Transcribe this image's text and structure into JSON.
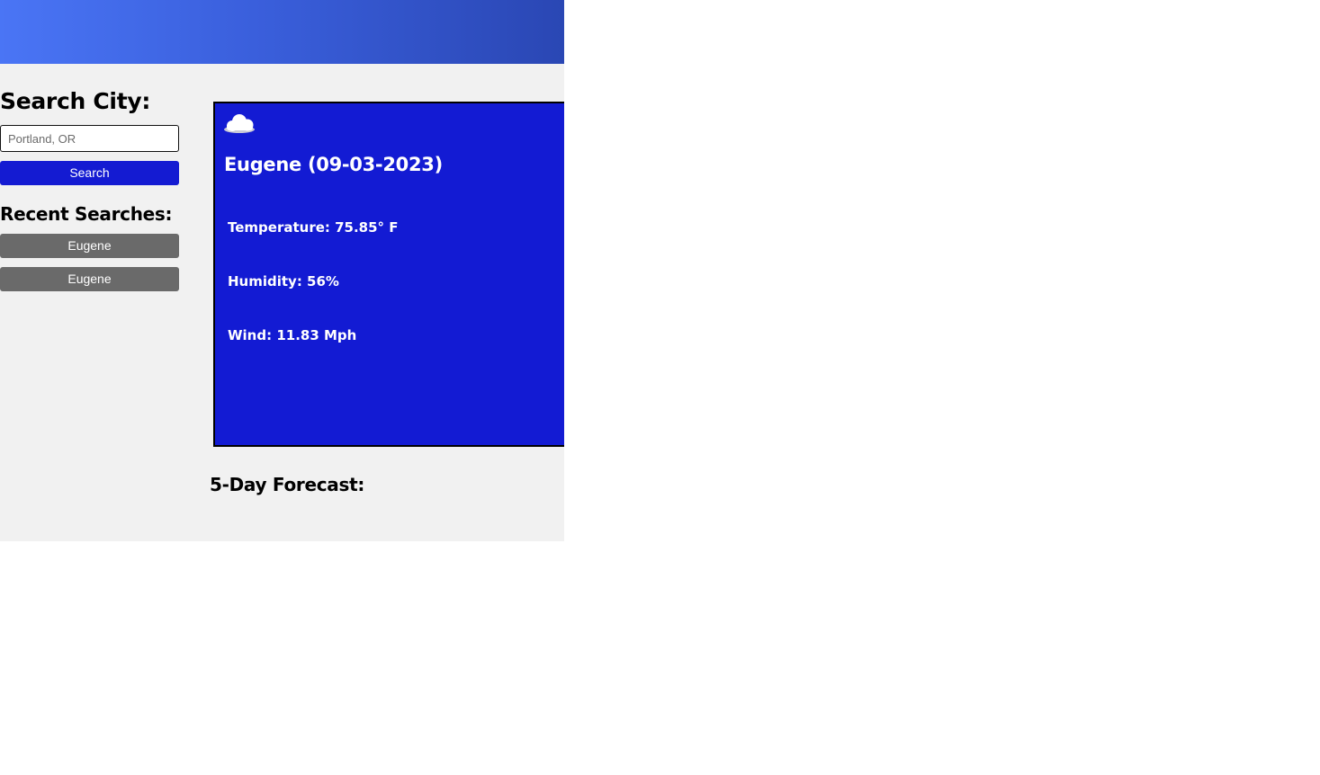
{
  "search": {
    "title": "Search City:",
    "placeholder": "Portland, OR",
    "button_label": "Search"
  },
  "recent": {
    "title": "Recent Searches:",
    "items": [
      {
        "label": "Eugene"
      },
      {
        "label": "Eugene"
      }
    ]
  },
  "current": {
    "icon": "cloud-icon",
    "city_date": "Eugene (09-03-2023)",
    "temperature": "Temperature: 75.85° F",
    "humidity": "Humidity: 56%",
    "wind": "Wind: 11.83 Mph"
  },
  "forecast": {
    "title": "5-Day Forecast:"
  },
  "colors": {
    "header_gradient_start": "#4a75f5",
    "header_gradient_end": "#2a47b4",
    "primary_blue": "#141bd2",
    "recent_button_gray": "#6a6a6a",
    "page_background": "#f1f1f1"
  }
}
